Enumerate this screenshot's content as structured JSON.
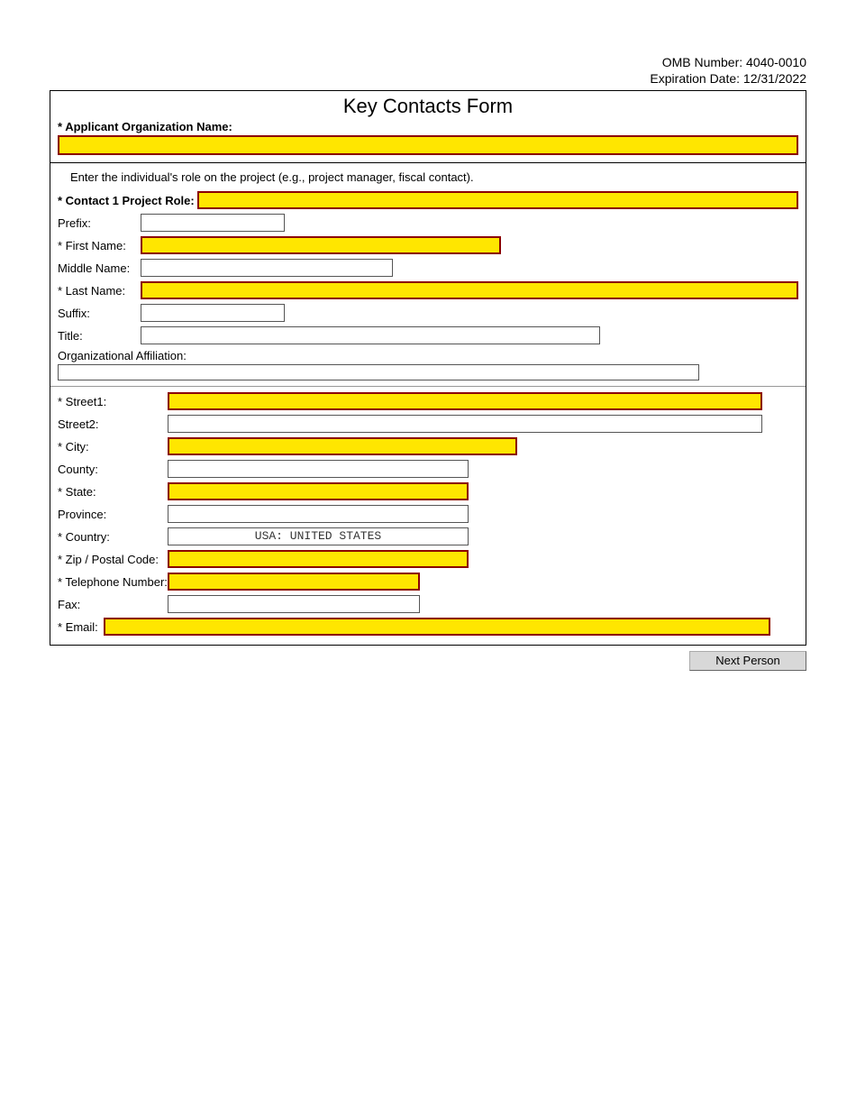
{
  "meta": {
    "omb_label": "OMB Number: 4040-0010",
    "exp_label": "Expiration Date: 12/31/2022"
  },
  "form": {
    "title": "Key Contacts Form",
    "org_label": "* Applicant Organization Name:"
  },
  "contact": {
    "instruction": "Enter the individual's role on the project (e.g., project manager, fiscal contact).",
    "role_label": "* Contact 1 Project Role:",
    "prefix_label": "Prefix:",
    "first_name_label": "* First Name:",
    "middle_name_label": "Middle Name:",
    "last_name_label": "* Last Name:",
    "suffix_label": "Suffix:",
    "title_label": "Title:",
    "org_aff_label": "Organizational Affiliation:",
    "street1_label": "* Street1:",
    "street2_label": "Street2:",
    "city_label": "* City:",
    "county_label": "County:",
    "state_label": "* State:",
    "province_label": "Province:",
    "country_label": "* Country:",
    "country_value": "USA: UNITED STATES",
    "zip_label": "* Zip / Postal Code:",
    "phone_label": "* Telephone Number:",
    "fax_label": "Fax:",
    "email_label": "* Email:"
  },
  "buttons": {
    "next_person": "Next Person"
  }
}
